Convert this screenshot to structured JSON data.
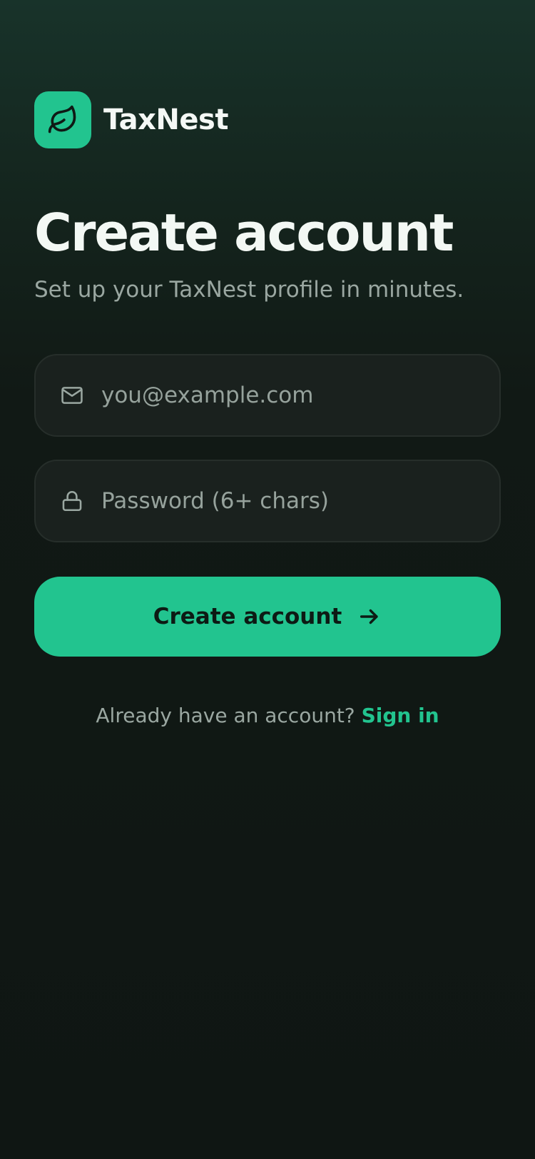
{
  "brand": {
    "name": "TaxNest",
    "logo_icon": "leaf-icon",
    "accent_color": "#22c48f"
  },
  "header": {
    "title": "Create account",
    "subtitle": "Set up your TaxNest profile in minutes."
  },
  "form": {
    "email": {
      "icon": "mail-icon",
      "value": "",
      "placeholder": "you@example.com"
    },
    "password": {
      "icon": "lock-icon",
      "value": "",
      "placeholder": "Password (6+ chars)"
    },
    "submit": {
      "label": "Create account",
      "icon": "arrow-right-icon"
    }
  },
  "footer": {
    "prompt": "Already have an account?",
    "link_label": "Sign in"
  }
}
